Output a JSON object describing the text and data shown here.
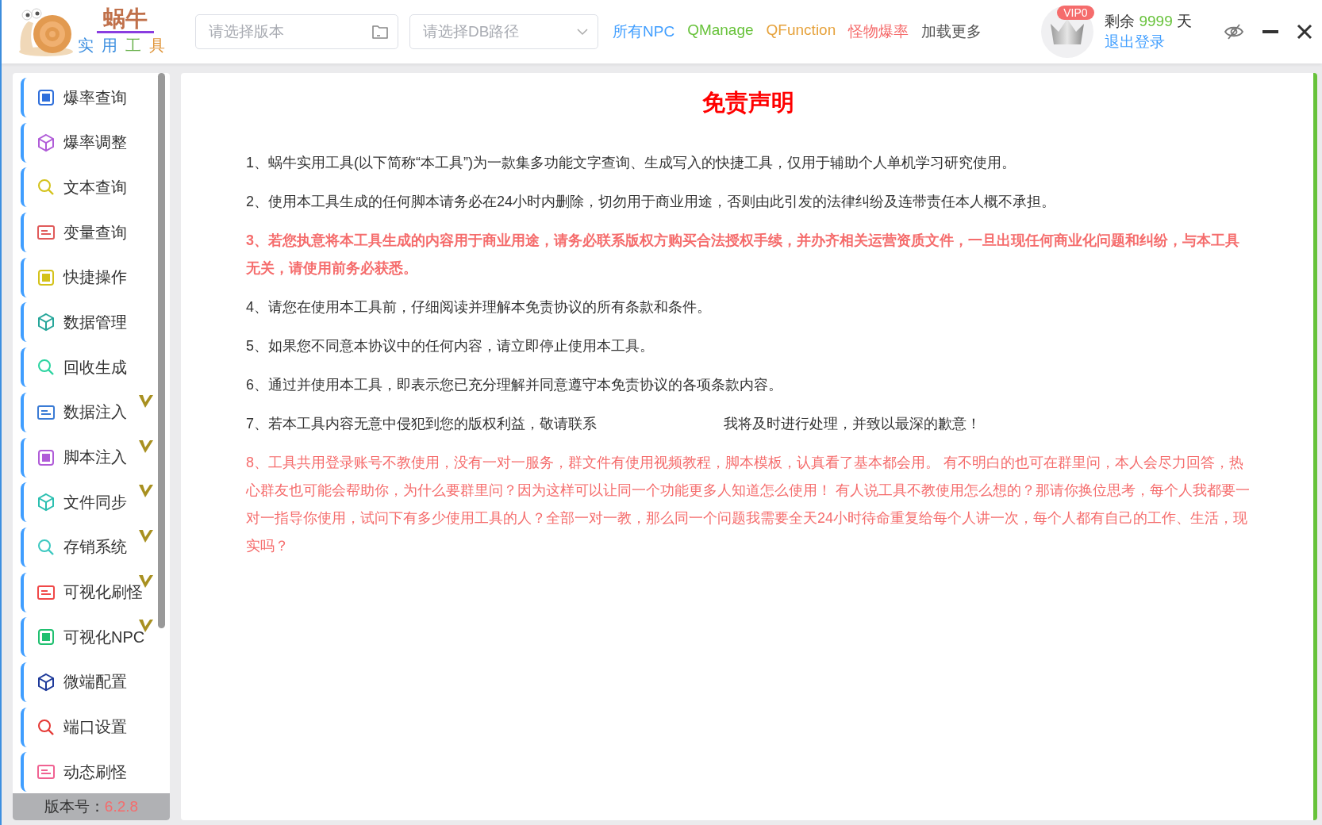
{
  "header": {
    "logo_title": "蜗牛",
    "logo_subtitle": [
      {
        "text": "实",
        "color": "#3d8fe0"
      },
      {
        "text": "用",
        "color": "#3d8fe0"
      },
      {
        "text": "工",
        "color": "#67b04a"
      },
      {
        "text": "具",
        "color": "#e0973d"
      }
    ],
    "version_field": {
      "placeholder": "请选择版本"
    },
    "db_field": {
      "placeholder": "请选择DB路径"
    },
    "links": [
      {
        "label": "所有NPC",
        "color": "#409eff"
      },
      {
        "label": "QManage",
        "color": "#67c23a"
      },
      {
        "label": "QFunction",
        "color": "#e6a23c"
      },
      {
        "label": "怪物爆率",
        "color": "#f56c6c"
      },
      {
        "label": "加载更多",
        "color": "#555555"
      }
    ],
    "vip_badge": "VIP0",
    "remaining_label": "剩余",
    "remaining_days": "9999",
    "days_unit": "天",
    "logout": "退出登录"
  },
  "sidebar": {
    "items": [
      {
        "label": "爆率查询",
        "vip": false
      },
      {
        "label": "爆率调整",
        "vip": false
      },
      {
        "label": "文本查询",
        "vip": false
      },
      {
        "label": "变量查询",
        "vip": false
      },
      {
        "label": "快捷操作",
        "vip": false
      },
      {
        "label": "数据管理",
        "vip": false
      },
      {
        "label": "回收生成",
        "vip": false
      },
      {
        "label": "数据注入",
        "vip": true
      },
      {
        "label": "脚本注入",
        "vip": true
      },
      {
        "label": "文件同步",
        "vip": true
      },
      {
        "label": "存销系统",
        "vip": true
      },
      {
        "label": "可视化刷怪",
        "vip": true
      },
      {
        "label": "可视化NPC",
        "vip": true
      },
      {
        "label": "微端配置",
        "vip": false
      },
      {
        "label": "端口设置",
        "vip": false
      },
      {
        "label": "动态刷怪",
        "vip": false
      }
    ],
    "version_label": "版本号：",
    "version": "6.2.8"
  },
  "content": {
    "title": "免责声明",
    "paragraphs": [
      {
        "kind": "normal",
        "text": "1、蜗牛实用工具(以下简称“本工具”)为一款集多功能文字查询、生成写入的快捷工具，仅用于辅助个人单机学习研究使用。"
      },
      {
        "kind": "normal",
        "text": "2、使用本工具生成的任何脚本请务必在24小时内删除，切勿用于商业用途，否则由此引发的法律纠纷及连带责任本人概不承担。"
      },
      {
        "kind": "warning",
        "text": "3、若您执意将本工具生成的内容用于商业用途，请务必联系版权方购买合法授权手续，并办齐相关运营资质文件，一旦出现任何商业化问题和纠纷，与本工具无关，请使用前务必获悉。"
      },
      {
        "kind": "normal",
        "text": "4、请您在使用本工具前，仔细阅读并理解本免责协议的所有条款和条件。"
      },
      {
        "kind": "normal",
        "text": "5、如果您不同意本协议中的任何内容，请立即停止使用本工具。"
      },
      {
        "kind": "normal",
        "text": "6、通过并使用本工具，即表示您已充分理解并同意遵守本免责协议的各项条款内容。"
      },
      {
        "kind": "split",
        "text": "7、若本工具内容无意中侵犯到您的版权利益，敬请联系",
        "text_after": "我将及时进行处理，并致以最深的歉意！"
      },
      {
        "kind": "note",
        "text": "8、工具共用登录账号不教使用，没有一对一服务，群文件有使用视频教程，脚本模板，认真看了基本都会用。 有不明白的也可在群里问，本人会尽力回答，热心群友也可能会帮助你，为什么要群里问？因为这样可以让同一个功能更多人知道怎么使用！ 有人说工具不教使用怎么想的？那请你换位思考，每个人我都要一对一指导你使用，试问下有多少使用工具的人？全部一对一教，那么同一个问题我需要全天24小时待命重复给每个人讲一次，每个人都有自己的工作、生活，现实吗？"
      }
    ]
  }
}
